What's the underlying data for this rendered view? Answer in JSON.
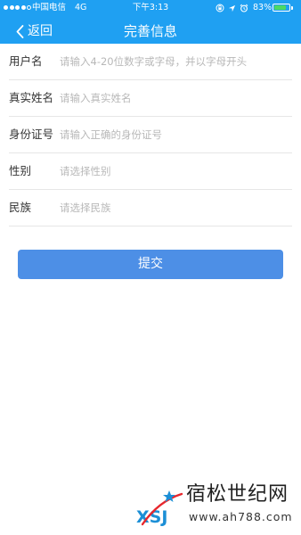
{
  "status_bar": {
    "carrier": "中国电信",
    "network": "4G",
    "time": "下午3:13",
    "battery_percent": "83%",
    "battery_level": 0.83,
    "signal_bars_filled": 4,
    "signal_bars_total": 5,
    "icons": [
      "lock-rotation-icon",
      "location-arrow-icon",
      "alarm-icon"
    ]
  },
  "nav": {
    "back_label": "返回",
    "back_icon": "chevron-left-icon",
    "title": "完善信息"
  },
  "form": {
    "rows": [
      {
        "label": "用户名",
        "placeholder": "请输入4-20位数字或字母，并以字母开头"
      },
      {
        "label": "真实姓名",
        "placeholder": "请输入真实姓名"
      },
      {
        "label": "身份证号",
        "placeholder": "请输入正确的身份证号"
      },
      {
        "label": "性别",
        "placeholder": "请选择性别"
      },
      {
        "label": "民族",
        "placeholder": "请选择民族"
      }
    ],
    "submit_label": "提交"
  },
  "watermark": {
    "logo_text": "XSJ",
    "name": "宿松世纪网",
    "url": "www.ah788.com"
  },
  "colors": {
    "header": "#1fa0f2",
    "button": "#4d8fe6",
    "battery": "#4cd964",
    "placeholder": "#b8b8b8",
    "divider": "#e6e6e6"
  }
}
